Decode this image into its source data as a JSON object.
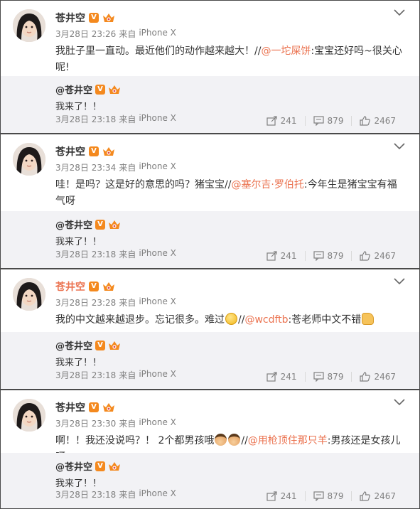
{
  "posts": [
    {
      "name": "苍井空",
      "verified": "V",
      "time": "3月28日 23:26",
      "source_prefix": "来自",
      "source": "iPhone X",
      "text_before": "我肚子里一直动。最近他们的动作越来越大！//",
      "mention": "@一坨屎饼",
      "text_after": ":宝宝还好吗~很关心呢!",
      "repost": {
        "name": "@苍井空",
        "text": "我来了！！",
        "time": "3月28日 23:18",
        "source_prefix": "来自",
        "source": "iPhone X",
        "shares": "241",
        "comments": "879",
        "likes": "2467"
      }
    },
    {
      "name": "苍井空",
      "verified": "V",
      "time": "3月28日 23:34",
      "source_prefix": "来自",
      "source": "iPhone X",
      "text_before": "哇！是吗？这是好的意思的吗？猪宝宝//",
      "mention": "@塞尔吉·罗伯托",
      "text_after": ":今年生是猪宝宝有福气呀",
      "repost": {
        "name": "@苍井空",
        "text": "我来了！！",
        "time": "3月28日 23:18",
        "source_prefix": "来自",
        "source": "iPhone X",
        "shares": "241",
        "comments": "879",
        "likes": "2467"
      }
    },
    {
      "name": "苍井空",
      "verified": "V",
      "time": "3月28日 23:28",
      "source_prefix": "来自",
      "source": "iPhone X",
      "text_before": "我的中文越来越退步。忘记很多。难过",
      "text_mid": "//",
      "mention": "@wcdftb",
      "text_after": ":苍老师中文不错",
      "repost": {
        "name": "@苍井空",
        "text": "我来了！！",
        "time": "3月28日 23:18",
        "source_prefix": "来自",
        "source": "iPhone X",
        "shares": "241",
        "comments": "879",
        "likes": "2467"
      }
    },
    {
      "name": "苍井空",
      "verified": "V",
      "time": "3月28日 23:30",
      "source_prefix": "来自",
      "source": "iPhone X",
      "text_before": "啊！！我还没说吗？！ 2个都男孩哦",
      "text_mid": "//",
      "mention": "@用枪顶住那只羊",
      "text_after": ":男孩还是女孩儿呀",
      "repost": {
        "name": "@苍井空",
        "text": "我来了！！",
        "time": "3月28日 23:18",
        "source_prefix": "来自",
        "source": "iPhone X",
        "shares": "241",
        "comments": "879",
        "likes": "2467"
      }
    }
  ],
  "icons": {
    "avatar": "avatar-photo",
    "verified": "verified-v-badge",
    "crown": "vip-crown-icon",
    "menu": "chevron-down-icon",
    "share": "share-icon",
    "comment": "comment-icon",
    "like": "thumbs-up-icon"
  },
  "colors": {
    "mention": "#eb7350",
    "badge": "#f4891e",
    "repost_bg": "#f2f2f5",
    "meta_text": "#808080"
  }
}
